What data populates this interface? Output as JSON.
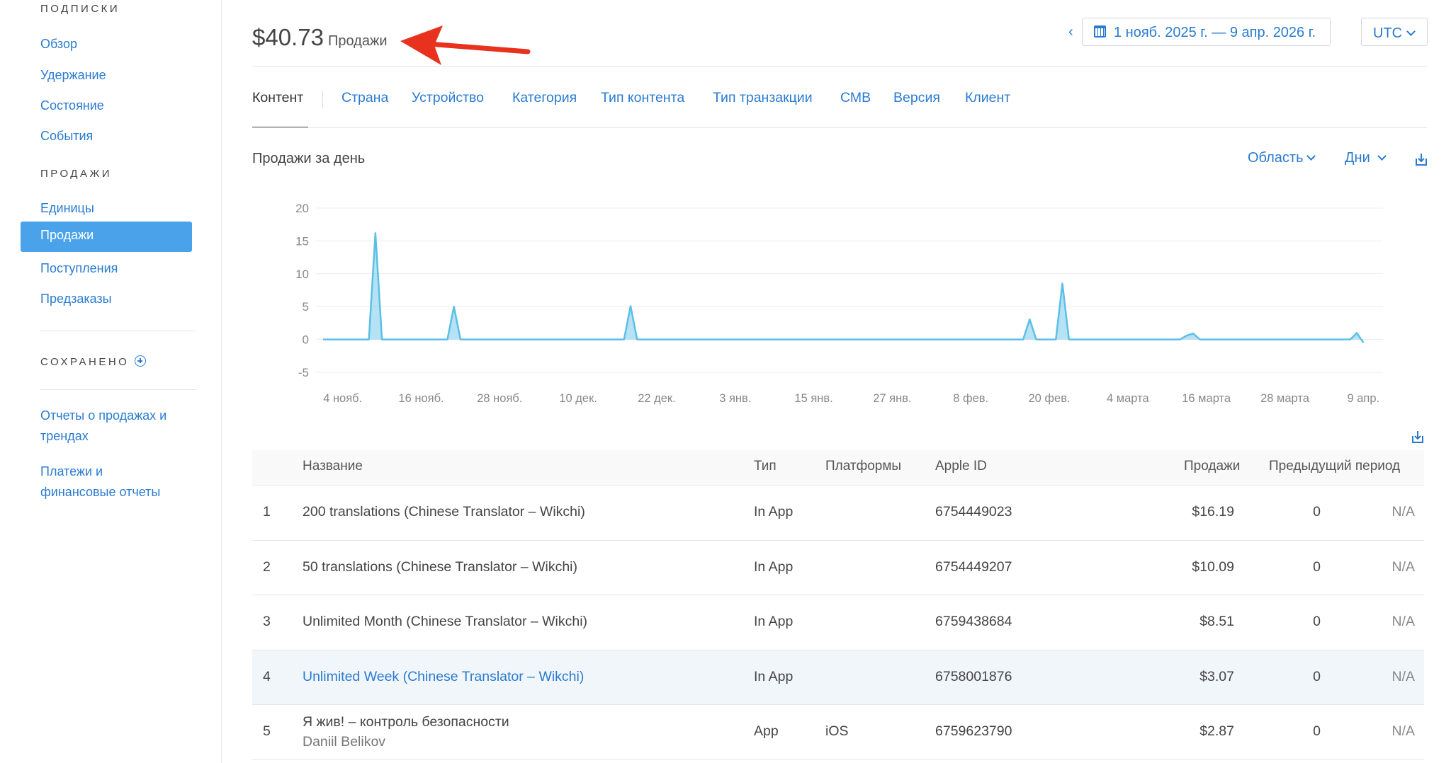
{
  "sidebar": {
    "section_subscriptions": "ПОДПИСКИ",
    "subscriptions_items": [
      "Обзор",
      "Удержание",
      "Состояние",
      "События"
    ],
    "section_sales": "ПРОДАЖИ",
    "sales_items": [
      "Единицы",
      "Продажи",
      "Поступления",
      "Предзаказы"
    ],
    "active_item": "Продажи",
    "section_saved": "СОХРАНЕНО",
    "reports": [
      "Отчеты о продажах и",
      "трендах",
      "Платежи и",
      "финансовые отчеты"
    ]
  },
  "header": {
    "amount": "$40.73",
    "label": "Продажи",
    "date_range": "1 нояб. 2025 г. — 9 апр. 2026 г.",
    "timezone": "UTC"
  },
  "tabs": [
    "Контент",
    "Страна",
    "Устройство",
    "Категория",
    "Тип контента",
    "Тип транзакции",
    "СМВ",
    "Версия",
    "Клиент"
  ],
  "chart_header": {
    "title": "Продажи за день",
    "chart_type_label": "Область",
    "interval_label": "Дни"
  },
  "chart_data": {
    "type": "area",
    "ylim": [
      -5,
      20
    ],
    "yticks": [
      20,
      15,
      10,
      5,
      0,
      -5
    ],
    "x_tick_labels": [
      "4 нояб.",
      "16 нояб.",
      "28 нояб.",
      "10 дек.",
      "22 дек.",
      "3 янв.",
      "15 янв.",
      "27 янв.",
      "8 фев.",
      "20 фев.",
      "4 марта",
      "16 марта",
      "28 марта",
      "9 апр."
    ],
    "x_start_day": 0,
    "x_tick_days": [
      3,
      15,
      27,
      39,
      51,
      63,
      75,
      87,
      99,
      111,
      123,
      135,
      147,
      159
    ],
    "series": [
      {
        "points": [
          [
            0,
            0
          ],
          [
            7,
            0
          ],
          [
            8,
            16.19
          ],
          [
            9,
            0
          ],
          [
            19,
            0
          ],
          [
            20,
            5.0
          ],
          [
            21,
            0
          ],
          [
            46,
            0
          ],
          [
            47,
            5.09
          ],
          [
            48,
            0
          ],
          [
            107,
            0
          ],
          [
            108,
            3.07
          ],
          [
            109,
            0
          ],
          [
            112,
            0
          ],
          [
            113,
            8.51
          ],
          [
            114,
            0
          ],
          [
            131,
            0
          ],
          [
            132,
            0.6
          ],
          [
            133,
            0.9
          ],
          [
            134,
            0
          ],
          [
            157,
            0
          ],
          [
            158,
            1.0
          ],
          [
            159,
            -0.5
          ]
        ]
      }
    ],
    "grid": true,
    "color": "#5bbfe6"
  },
  "table": {
    "headers": [
      "Название",
      "Тип",
      "Платформы",
      "Apple ID",
      "Продажи",
      "Предыдущий период"
    ],
    "rows": [
      {
        "n": "1",
        "name": "200 translations (Chinese Translator – Wikchi)",
        "sub": "",
        "type": "In App",
        "platform": "",
        "apple_id": "6754449023",
        "sales": "$16.19",
        "prev": "0",
        "change": "N/A"
      },
      {
        "n": "2",
        "name": "50 translations (Chinese Translator – Wikchi)",
        "sub": "",
        "type": "In App",
        "platform": "",
        "apple_id": "6754449207",
        "sales": "$10.09",
        "prev": "0",
        "change": "N/A"
      },
      {
        "n": "3",
        "name": "Unlimited Month (Chinese Translator – Wikchi)",
        "sub": "",
        "type": "In App",
        "platform": "",
        "apple_id": "6759438684",
        "sales": "$8.51",
        "prev": "0",
        "change": "N/A"
      },
      {
        "n": "4",
        "name": "Unlimited Week (Chinese Translator – Wikchi)",
        "sub": "",
        "type": "In App",
        "platform": "",
        "apple_id": "6758001876",
        "sales": "$3.07",
        "prev": "0",
        "change": "N/A"
      },
      {
        "n": "5",
        "name": "Я жив! – контроль безопасности",
        "sub": "Daniil Belikov",
        "type": "App",
        "platform": "iOS",
        "apple_id": "6759623790",
        "sales": "$2.87",
        "prev": "0",
        "change": "N/A"
      }
    ]
  },
  "colors": {
    "accent": "#2a7bd0",
    "active_bg": "#4aa3ea",
    "chart": "#5bbfe6",
    "arrow": "#e8321e"
  }
}
